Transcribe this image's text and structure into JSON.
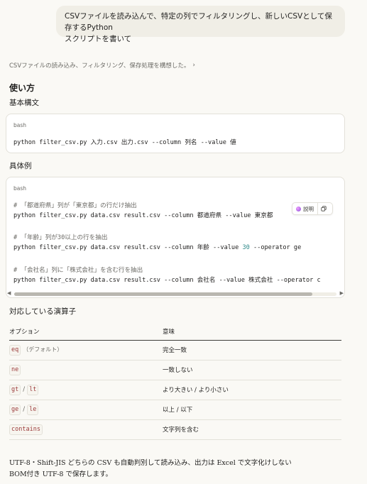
{
  "user_message": {
    "line1": "CSVファイルを読み込んで、特定の列でフィルタリングし、新しいCSVとして保存するPython",
    "line2": "スクリプトを書いて"
  },
  "thinking": {
    "summary": "CSVファイルの読み込み、フィルタリング、保存処理を構想した。",
    "chevron_icon": "chevron-right-icon"
  },
  "headings": {
    "usage": "使い方",
    "basic": "基本構文",
    "example": "具体例",
    "operators": "対応している演算子"
  },
  "basic_code": {
    "lang": "bash",
    "line": "python filter_csv.py 入力.csv 出力.csv --column 列名 --value 値"
  },
  "example_code": {
    "lang": "bash",
    "c1": "# 「都道府県」列が「東京都」の行だけ抽出",
    "l1": "python filter_csv.py data.csv result.csv --column 都道府県 --value 東京都",
    "c2": "# 「年齢」列が30以上の行を抽出",
    "l2a": "python filter_csv.py data.csv result.csv --column 年齢 --value ",
    "l2num": "30",
    "l2b": " --operator ge",
    "c3": "# 「会社名」列に「株式会社」を含む行を抽出",
    "l3": "python filter_csv.py data.csv result.csv --column 会社名 --value 株式会社 --operator c"
  },
  "explain_button": {
    "label": "説明",
    "copy_icon": "copy-icon"
  },
  "ops_table": {
    "header_option": "オプション",
    "header_meaning": "意味",
    "rows": [
      {
        "codes": [
          "eq"
        ],
        "note": "（デフォルト）",
        "meaning": "完全一致"
      },
      {
        "codes": [
          "ne"
        ],
        "note": "",
        "meaning": "一致しない"
      },
      {
        "codes": [
          "gt",
          "lt"
        ],
        "note": "",
        "meaning": "より大きい / より小さい"
      },
      {
        "codes": [
          "ge",
          "le"
        ],
        "note": "",
        "meaning": "以上 / 以下"
      },
      {
        "codes": [
          "contains"
        ],
        "note": "",
        "meaning": "文字列を含む"
      }
    ],
    "slash": "/"
  },
  "footer": {
    "line1": "UTF-8・Shift-JIS どちらの CSV も自動判別して読み込み、出力は Excel で文字化けしない",
    "line2": "BOM付き UTF-8 で保存します。"
  }
}
